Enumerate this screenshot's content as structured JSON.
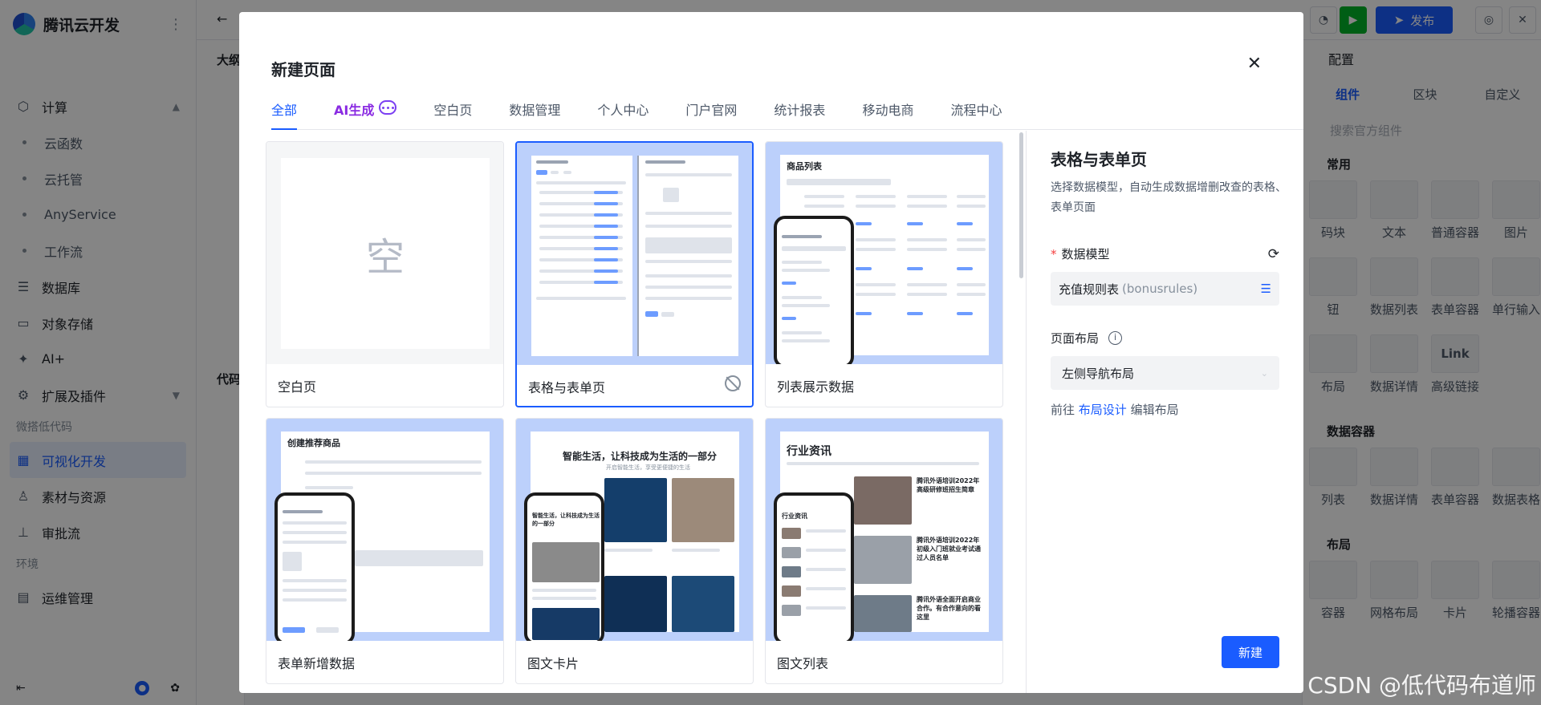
{
  "app": {
    "brand": "腾讯云开发",
    "nav": {
      "compute": "计算",
      "compute_children": [
        "云函数",
        "云托管",
        "AnyService",
        "工作流"
      ],
      "database": "数据库",
      "object_storage": "对象存储",
      "ai_plus": "AI+",
      "extensions": "扩展及插件",
      "group_lowcode": "微搭低代码",
      "visual_dev": "可视化开发",
      "assets": "素材与资源",
      "approval": "审批流",
      "group_env": "环境",
      "ops": "运维管理"
    },
    "topbar": {
      "publish": "发布"
    },
    "canvas": {
      "outline_tab": "大纲",
      "code_label": "代码"
    },
    "right_panel": {
      "header": "配置",
      "tabs": [
        "组件",
        "区块",
        "自定义"
      ],
      "search_placeholder": "搜索官方组件",
      "sections": {
        "common": "常用",
        "data_container": "数据容器",
        "layout": "布局"
      },
      "common_items": [
        "码块",
        "文本",
        "普通容器",
        "图片",
        "钮",
        "数据列表",
        "表单容器",
        "单行输入",
        "布局",
        "数据详情",
        "高级链接"
      ],
      "link_text": "Link",
      "data_items": [
        "列表",
        "数据详情",
        "表单容器",
        "数据表格"
      ],
      "layout_items": [
        "容器",
        "网格布局",
        "卡片",
        "轮播容器"
      ]
    }
  },
  "modal": {
    "title": "新建页面",
    "tabs": [
      "全部",
      "AI生成",
      "空白页",
      "数据管理",
      "个人中心",
      "门户官网",
      "统计报表",
      "移动电商",
      "流程中心"
    ],
    "active_tab": "全部",
    "cards": [
      {
        "label": "空白页",
        "preview_text": "空"
      },
      {
        "label": "表格与表单页"
      },
      {
        "label": "列表展示数据"
      },
      {
        "label": "表单新增数据"
      },
      {
        "label": "图文卡片"
      },
      {
        "label": "图文列表"
      }
    ],
    "preview": {
      "list_title": "商品列表",
      "form_title": "创建推荐商品",
      "card_headline": "智能生活，让科技成为生活的一部分",
      "card_sub": "开启智能生活，享受更便捷的生活",
      "card_phone_headline": "智能生活，让科技成为生活的一部分",
      "news_title": "行业资讯",
      "news_item_1": "腾讯外语培训2022年高级研修班招生简章",
      "news_item_2": "腾讯外语培训2022年初级入门班就业考试通过人员名单",
      "news_item_3": "腾讯外语全面开启商业合作。有合作意向的看这里",
      "news_phone_title": "行业资讯"
    },
    "config": {
      "title": "表格与表单页",
      "description": "选择数据模型，自动生成数据增删改查的表格、表单页面",
      "data_model_label": "数据模型",
      "data_model_value": "充值规则表",
      "data_model_key": "(bonusrules)",
      "layout_label": "页面布局",
      "layout_value": "左侧导航布局",
      "goto_prefix": "前往",
      "goto_link": "布局设计",
      "goto_suffix": "编辑布局",
      "create_button": "新建"
    }
  },
  "watermark": "CSDN @低代码布道师"
}
